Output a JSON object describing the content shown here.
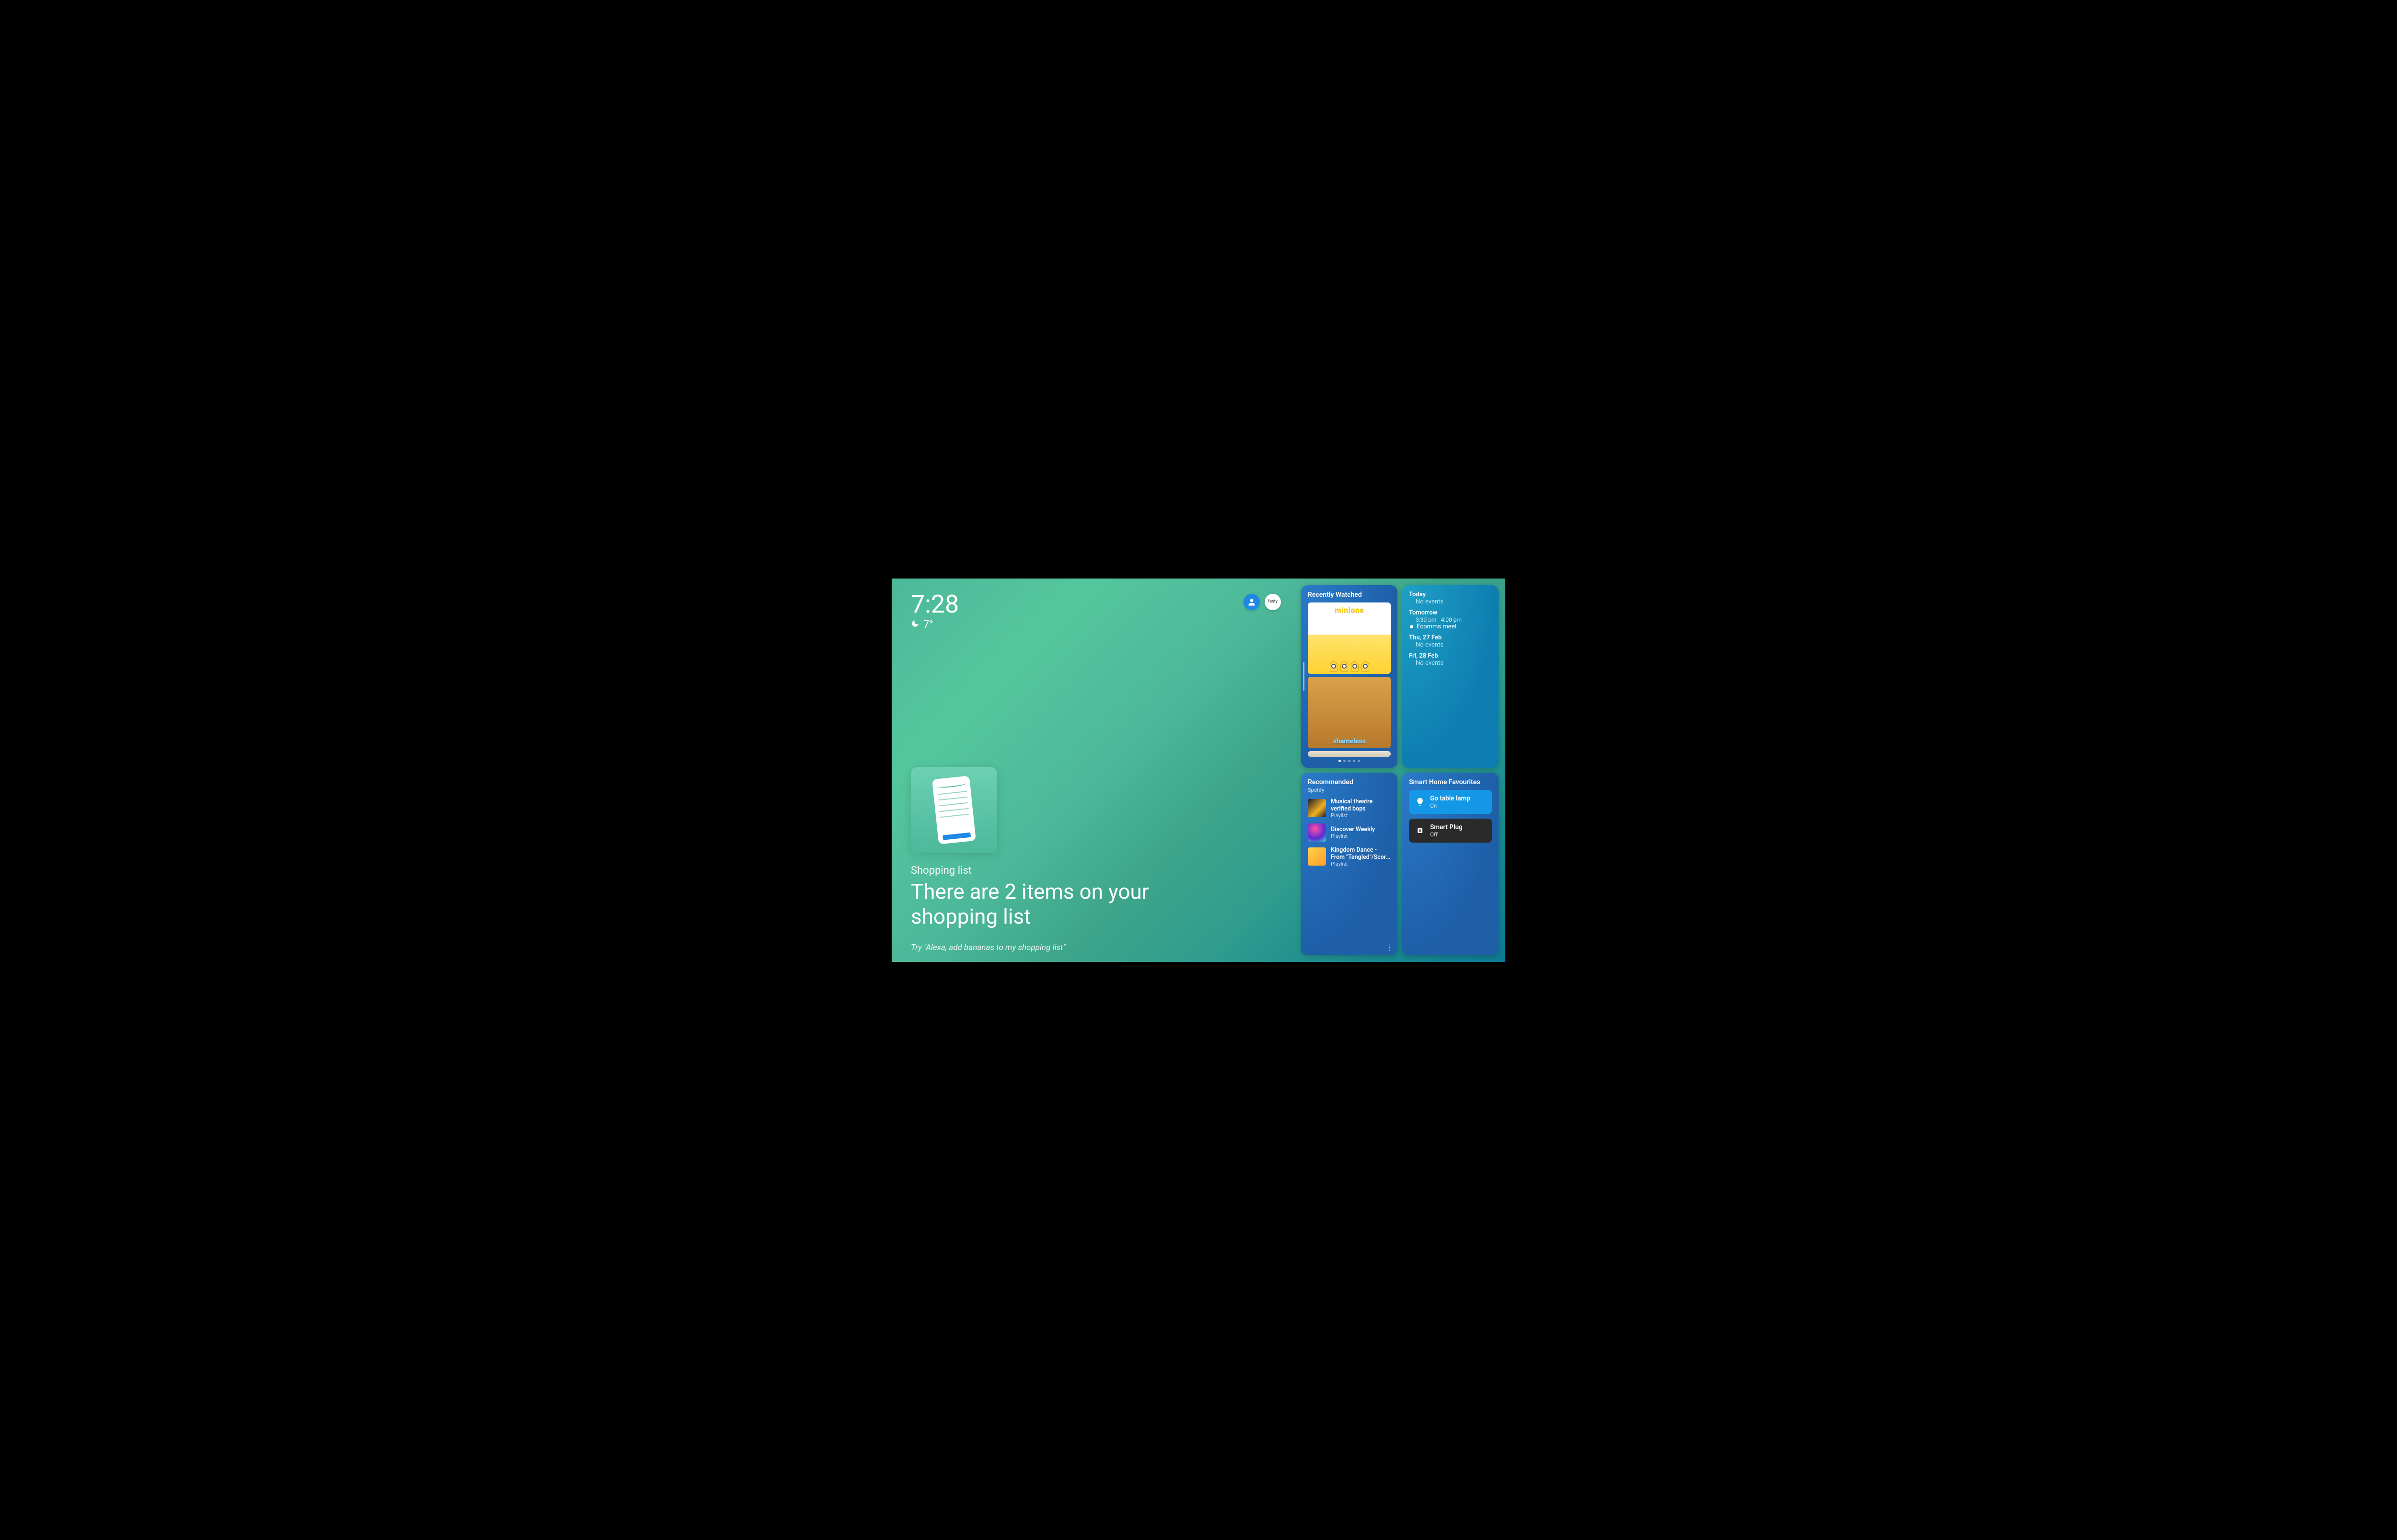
{
  "clock": {
    "time": "7:28",
    "weather_icon": "moon",
    "temperature": "7°"
  },
  "profile_icons": [
    {
      "name": "user-profile-icon",
      "kind": "person",
      "color": "#1e88e5"
    },
    {
      "name": "service-badge-icon",
      "kind": "badge-text",
      "text": "fasty"
    }
  ],
  "hero": {
    "subtitle": "Shopping list",
    "title": "There are 2 items on your shopping list",
    "hint": "Try \"Alexa, add bananas to my shopping list\""
  },
  "widgets": {
    "recently_watched": {
      "title": "Recently Watched",
      "items": [
        {
          "label": "minions"
        },
        {
          "label": "shameless"
        }
      ]
    },
    "calendar": {
      "days": [
        {
          "label": "Today",
          "no_events_text": "No events"
        },
        {
          "label": "Tomorrow",
          "time": "3:30 pm - 4:00 pm",
          "event": "Ecomms meet"
        },
        {
          "label": "Thu, 27 Feb",
          "no_events_text": "No events"
        },
        {
          "label": "Fri, 28 Feb",
          "no_events_text": "No events"
        }
      ]
    },
    "recommended": {
      "title": "Recommended",
      "provider": "Spotify",
      "items": [
        {
          "name": "Musical theatre verified bops",
          "type_label": "Playlist"
        },
        {
          "name": "Discover Weekly",
          "type_label": "Playlist"
        },
        {
          "name": "Kingdom Dance - From \"Tangled\"/Score Radio",
          "type_label": "Playlist"
        }
      ]
    },
    "smart_home": {
      "title": "Smart Home Favourites",
      "devices": [
        {
          "name": "Go table lamp",
          "state": "On",
          "on": true,
          "icon": "bulb"
        },
        {
          "name": "Smart Plug",
          "state": "Off",
          "on": false,
          "icon": "plug"
        }
      ]
    }
  }
}
